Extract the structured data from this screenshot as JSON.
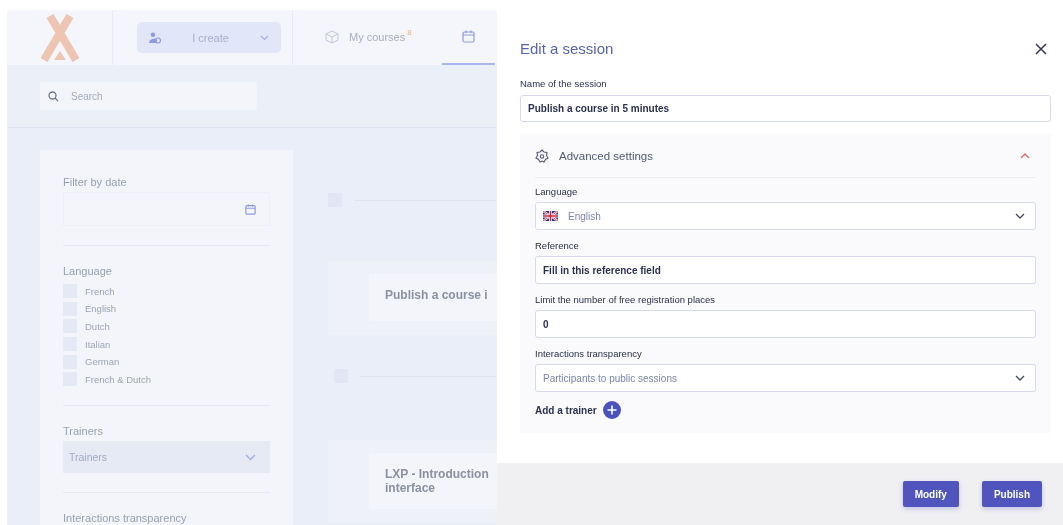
{
  "header": {
    "role_selector": {
      "label": "I create"
    },
    "tabs": [
      {
        "label": "My courses",
        "badge": "8",
        "selected": false
      },
      {
        "selected": true
      }
    ]
  },
  "search": {
    "placeholder": "Search"
  },
  "filters": {
    "date": {
      "label": "Filter by date"
    },
    "language": {
      "label": "Language",
      "options": [
        {
          "label": "French",
          "checked": false
        },
        {
          "label": "English",
          "checked": false
        },
        {
          "label": "Dutch",
          "checked": false
        },
        {
          "label": "Italian",
          "checked": false
        },
        {
          "label": "German",
          "checked": false
        },
        {
          "label": "French & Dutch",
          "checked": false
        }
      ]
    },
    "trainers": {
      "label": "Trainers",
      "placeholder": "Trainers"
    },
    "interactions": {
      "label": "Interactions transparency"
    }
  },
  "courses": [
    {
      "kind": "checkbox-row",
      "checked": false
    },
    {
      "kind": "course",
      "title": "Publish a course i"
    },
    {
      "kind": "checkbox-row",
      "checked": false
    },
    {
      "kind": "course",
      "title": "LXP - Introduction interface"
    }
  ],
  "drawer": {
    "title": "Edit a session",
    "name_field": {
      "label": "Name of the session",
      "value": "Publish a course in 5 minutes"
    },
    "advanced": {
      "title": "Advanced settings",
      "expanded": true,
      "fields": [
        {
          "kind": "language-select",
          "label": "Language",
          "value": "English"
        },
        {
          "kind": "input",
          "label": "Reference",
          "value": "Fill in this reference field"
        },
        {
          "kind": "input",
          "label": "Limit the number of free registration places",
          "value": "0"
        },
        {
          "kind": "select",
          "label": "Interactions transparency",
          "value": "Participants to public sessions"
        }
      ],
      "add_trainer": {
        "label": "Add a trainer"
      }
    },
    "buttons": [
      {
        "label": "Modify"
      },
      {
        "label": "Publish"
      }
    ]
  }
}
